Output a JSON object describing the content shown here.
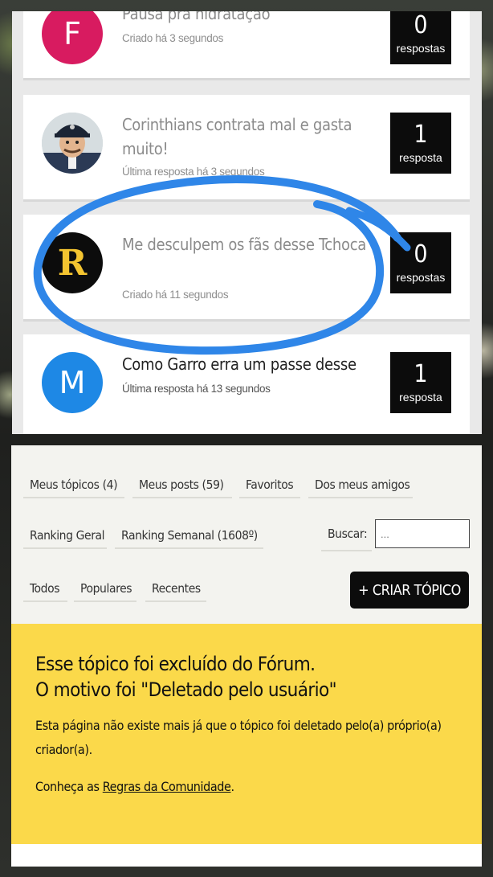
{
  "topics": [
    {
      "avatar_letter": "F",
      "avatar_color": "#d81b60",
      "title": "Pausa pra hidratação",
      "meta": "Criado há 3 segundos",
      "count": "0",
      "count_label": "respostas"
    },
    {
      "avatar_icon": "cartoon-character-avatar",
      "title": "Corinthians contrata mal e gasta muito!",
      "meta": "Última resposta há 3 segundos",
      "count": "1",
      "count_label": "resposta"
    },
    {
      "avatar_letter": "R",
      "avatar_color": "#0c0c0c",
      "avatar_letter_color": "#f4c430",
      "title": "Me desculpem os fãs desse Tchoca",
      "meta": "Criado há 11 segundos",
      "count": "0",
      "count_label": "respostas"
    },
    {
      "avatar_letter": "M",
      "avatar_color": "#1e88e5",
      "title": "Como Garro erra um passe desse",
      "meta": "Última resposta há 13 segundos",
      "count": "1",
      "count_label": "resposta"
    }
  ],
  "highlight_color": "#2f86e8",
  "nav": {
    "my_topics": "Meus tópicos (4)",
    "my_posts": "Meus posts (59)",
    "favorites": "Favoritos",
    "friends": "Dos meus amigos",
    "ranking_general": "Ranking Geral",
    "ranking_weekly": "Ranking Semanal (1608º)",
    "search_label": "Buscar:",
    "search_placeholder": "...",
    "filter_all": "Todos",
    "filter_popular": "Populares",
    "filter_recent": "Recentes",
    "create_topic": "+ CRIAR TÓPICO"
  },
  "notice": {
    "title_line1": "Esse tópico foi excluído do Fórum.",
    "title_line2": "O motivo foi \"Deletado pelo usuário\"",
    "description": "Esta página não existe mais já que o tópico foi deletado pelo(a) próprio(a) criador(a).",
    "rules_prefix": "Conheça as ",
    "rules_link": "Regras da Comunidade",
    "rules_suffix": ".",
    "background_color": "#fbd94a"
  }
}
